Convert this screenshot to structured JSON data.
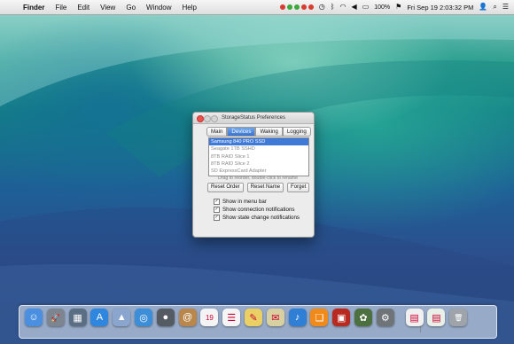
{
  "menubar": {
    "apple_glyph": "",
    "app_name": "Finder",
    "menus": [
      "File",
      "Edit",
      "View",
      "Go",
      "Window",
      "Help"
    ],
    "battery": "100%",
    "datetime": "Fri Sep 19  2:03:32 PM"
  },
  "window": {
    "title": "StorageStatus Preferences",
    "tabs": [
      "Main",
      "Devices",
      "Waking",
      "Logging"
    ],
    "active_tab": "Devices",
    "devices": [
      "Samsung 840 PRO SSD",
      "Seagate 1TB SSHD",
      "8TB RAID Slice 1",
      "8TB RAID Slice 2",
      "SD ExpressCard Adapter"
    ],
    "selected_device": "Samsung 840 PRO SSD",
    "hint": "Drag to reorder, double-click to rename",
    "buttons": {
      "reset_order": "Reset Order",
      "reset_name": "Reset Name",
      "forget": "Forget"
    },
    "options": [
      {
        "label": "Show in menu bar",
        "checked": true
      },
      {
        "label": "Show connection notifications",
        "checked": true
      },
      {
        "label": "Show state change notifications",
        "checked": true
      }
    ]
  },
  "dock": {
    "apps": [
      {
        "name": "finder-icon",
        "glyph": "☺",
        "color": "#4a8fe0"
      },
      {
        "name": "launchpad-icon",
        "glyph": "🚀",
        "color": "#7d8690"
      },
      {
        "name": "mission-control-icon",
        "glyph": "▦",
        "color": "#5a6e84"
      },
      {
        "name": "app-store-icon",
        "glyph": "A",
        "color": "#2f86de"
      },
      {
        "name": "preview-icon",
        "glyph": "▲",
        "color": "#8aa6cf"
      },
      {
        "name": "safari-icon",
        "glyph": "◎",
        "color": "#3c8ed8"
      },
      {
        "name": "facetime-icon",
        "glyph": "●",
        "color": "#555b62"
      },
      {
        "name": "contacts-icon",
        "glyph": "@",
        "color": "#b9874b"
      },
      {
        "name": "calendar-icon",
        "glyph": "19",
        "color": "#f4f4f4"
      },
      {
        "name": "reminders-icon",
        "glyph": "☰",
        "color": "#f5f5f5"
      },
      {
        "name": "notes-icon",
        "glyph": "✎",
        "color": "#e9cf64"
      },
      {
        "name": "image-capture-icon",
        "glyph": "✉",
        "color": "#d8d0a0"
      },
      {
        "name": "itunes-icon",
        "glyph": "♪",
        "color": "#2f7fd6"
      },
      {
        "name": "ibooks-icon",
        "glyph": "❑",
        "color": "#f08a1a"
      },
      {
        "name": "photo-booth-icon",
        "glyph": "▣",
        "color": "#b8291f"
      },
      {
        "name": "iphoto-icon",
        "glyph": "✿",
        "color": "#4d7040"
      },
      {
        "name": "system-preferences-icon",
        "glyph": "⚙",
        "color": "#6f7479"
      },
      {
        "name": "documents-stack-icon",
        "glyph": "▤",
        "color": "#f0f0f0"
      },
      {
        "name": "downloads-stack-icon",
        "glyph": "▤",
        "color": "#e8f0e8"
      },
      {
        "name": "trash-icon",
        "glyph": "🗑",
        "color": "#9ea4aa"
      }
    ]
  }
}
